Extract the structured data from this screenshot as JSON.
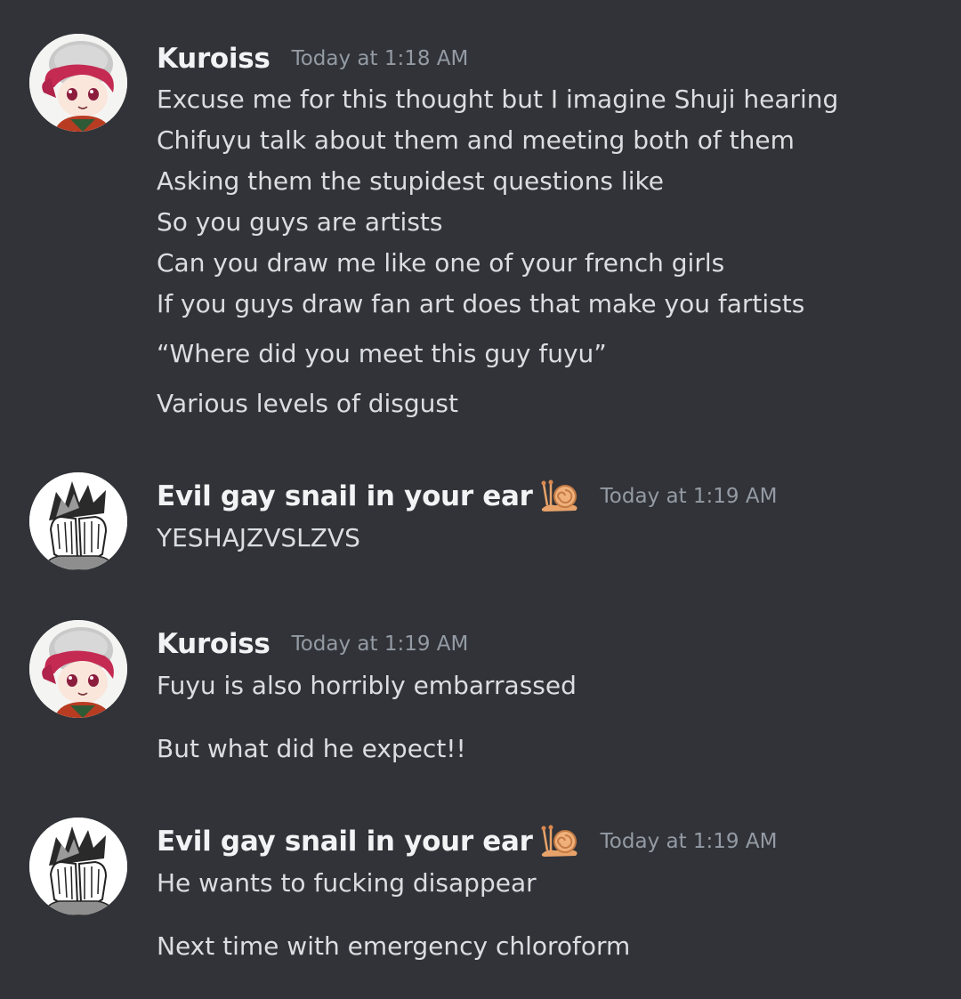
{
  "messages": [
    {
      "username": "Kuroiss",
      "timestamp": "Today at 1:18 AM",
      "avatar": "red-haired-plush-avatar",
      "lines": [
        "Excuse me for this thought but I imagine Shuji hearing",
        "Chifuyu talk about them and meeting both of them",
        "Asking them the stupidest questions like",
        "So you guys are artists",
        "Can you draw me like one of your french girls",
        "If you guys draw fan art does that make you fartists",
        "“Where did you meet this guy fuyu”",
        "Various levels of disgust"
      ]
    },
    {
      "username": "Evil gay snail in your ear",
      "timestamp": "Today at 1:19 AM",
      "avatar": "manga-face-palm-avatar",
      "badge": "snail-icon",
      "lines": [
        "YESHAJZVSLZVS"
      ]
    },
    {
      "username": "Kuroiss",
      "timestamp": "Today at 1:19 AM",
      "avatar": "red-haired-plush-avatar",
      "lines": [
        "Fuyu is also horribly embarrassed",
        "But what did he expect!!"
      ]
    },
    {
      "username": "Evil gay snail in your ear",
      "timestamp": "Today at 1:19 AM",
      "avatar": "manga-face-palm-avatar",
      "badge": "snail-icon",
      "lines": [
        "He wants to fucking disappear",
        "Next time with emergency chloroform"
      ]
    }
  ],
  "colors": {
    "background": "#313338",
    "username": "#f2f3f5",
    "message_text": "#dbdee1",
    "timestamp": "#949ba4"
  }
}
